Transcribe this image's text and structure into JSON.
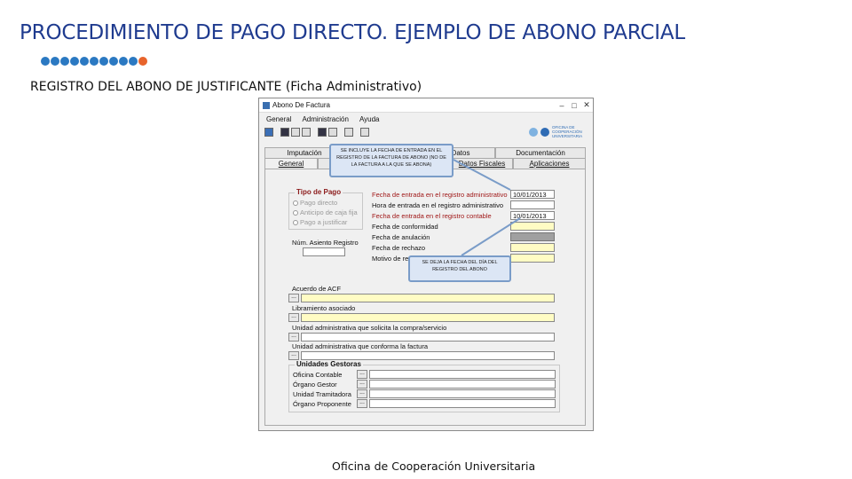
{
  "slide": {
    "title": "PROCEDIMIENTO DE PAGO DIRECTO. EJEMPLO DE ABONO PARCIAL",
    "subtitle": "REGISTRO DEL ABONO DE JUSTIFICANTE (Ficha Administrativo)",
    "footer": "Oficina de Cooperación Universitaria",
    "dot_colors": [
      "#2b79c2",
      "#2b79c2",
      "#2b79c2",
      "#2b79c2",
      "#2b79c2",
      "#2b79c2",
      "#2b79c2",
      "#2b79c2",
      "#2b79c2",
      "#2b79c2",
      "#e8642c"
    ]
  },
  "window": {
    "title": "Abono De Factura",
    "menu": [
      "General",
      "Administración",
      "Ayuda"
    ],
    "logo_text": "OFICINA DE COOPERACIÓN UNIVERSITARIA",
    "tabs_row1": [
      "Imputación",
      "",
      "Datos",
      "Documentación"
    ],
    "tabs_row2": [
      "General",
      "",
      "Datos Fiscales",
      "Aplicaciones"
    ],
    "tipo_pago": {
      "title": "Tipo de Pago",
      "options": [
        "Pago directo",
        "Anticipo de caja fija",
        "Pago a justificar"
      ]
    },
    "num_asiento_label": "Núm. Asiento Registro",
    "fechas": [
      {
        "label": "Fecha de entrada en el registro administrativo",
        "value": "10/01/2013",
        "red": true,
        "style": ""
      },
      {
        "label": "Hora de entrada en el registro administrativo",
        "value": "",
        "red": false,
        "style": ""
      },
      {
        "label": "Fecha de entrada en el registro contable",
        "value": "10/01/2013",
        "red": true,
        "style": ""
      },
      {
        "label": "Fecha de conformidad",
        "value": "",
        "red": false,
        "style": "yel"
      },
      {
        "label": "Fecha de anulación",
        "value": "",
        "red": false,
        "style": "gray"
      },
      {
        "label": "Fecha de rechazo",
        "value": "",
        "red": false,
        "style": "yel"
      },
      {
        "label": "Motivo de rechazo",
        "value": "",
        "red": false,
        "style": "yel"
      }
    ],
    "acuerdo_label": "Acuerdo de ACF",
    "libramiento_label": "Libramiento asociado",
    "unidad_solicita_label": "Unidad administrativa que solicita la compra/servicio",
    "unidad_conforma_label": "Unidad administrativa que conforma la factura",
    "unidades": {
      "title": "Unidades Gestoras",
      "rows": [
        "Oficina Contable",
        "Órgano Gestor",
        "Unidad Tramitadora",
        "Órgano Proponente"
      ]
    },
    "ellipsis": "..."
  },
  "callouts": {
    "top": "SE INCLUYE LA FECHA DE ENTRADA EN EL REGISTRO DE LA FACTURA DE ABONO (NO DE LA FACTURA A LA QUE SE ABONA)",
    "bottom": "SE DEJA LA FECHA DEL DÍA DEL REGISTRO DEL ABONO"
  }
}
